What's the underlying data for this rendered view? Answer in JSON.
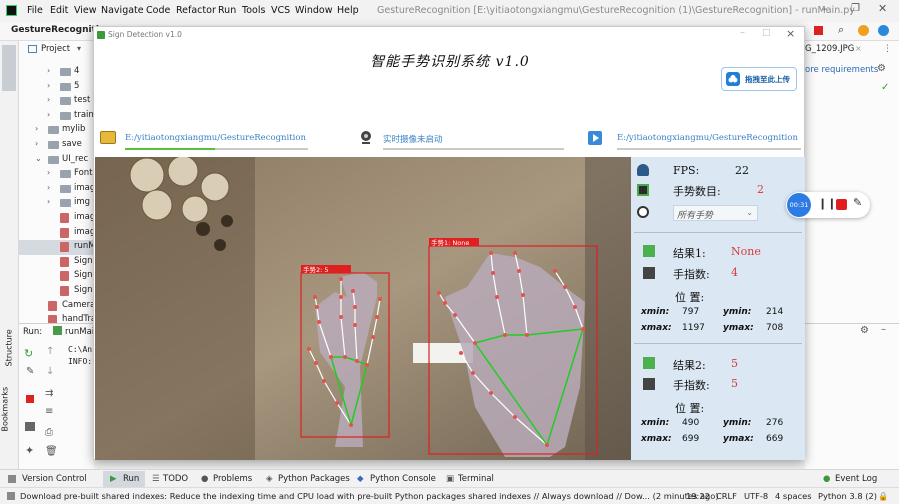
{
  "ide": {
    "menu": [
      "File",
      "Edit",
      "View",
      "Navigate",
      "Code",
      "Refactor",
      "Run",
      "Tools",
      "VCS",
      "Window",
      "Help"
    ],
    "title": "GestureRecognition [E:\\yitiaotongxiangmu\\GestureRecognition (1)\\GestureRecognition] - runMain.py",
    "project_name": "GestureRecognition",
    "project_label": "Project",
    "tree": [
      {
        "label": "4",
        "kind": "folder",
        "indent": 2
      },
      {
        "label": "5",
        "kind": "folder",
        "indent": 2
      },
      {
        "label": "test",
        "kind": "folder",
        "indent": 2
      },
      {
        "label": "train",
        "kind": "folder",
        "indent": 2
      },
      {
        "label": "mylib",
        "kind": "folder",
        "indent": 1
      },
      {
        "label": "save",
        "kind": "folder",
        "indent": 1
      },
      {
        "label": "UI_rec",
        "kind": "folder-open",
        "indent": 1
      },
      {
        "label": "Font",
        "kind": "folder",
        "indent": 2
      },
      {
        "label": "imag",
        "kind": "folder",
        "indent": 2
      },
      {
        "label": "img",
        "kind": "folder",
        "indent": 2
      },
      {
        "label": "imag",
        "kind": "file",
        "indent": 2
      },
      {
        "label": "imag",
        "kind": "file",
        "indent": 2
      },
      {
        "label": "runM",
        "kind": "file",
        "indent": 2
      },
      {
        "label": "Sign",
        "kind": "file",
        "indent": 2
      },
      {
        "label": "Sign",
        "kind": "file",
        "indent": 2
      },
      {
        "label": "Sign",
        "kind": "file",
        "indent": 2
      },
      {
        "label": "Camera",
        "kind": "file",
        "indent": 1
      },
      {
        "label": "handTra",
        "kind": "file",
        "indent": 1
      }
    ],
    "run_label": "Run:",
    "run_tab": "runMai",
    "console_lines": [
      "C:\\An",
      "INFO:"
    ],
    "editor_tab": "G_1209.JPG",
    "requirements_hint": "ore requirements",
    "side_labels": [
      "Structure",
      "Bookmarks"
    ],
    "bottom_tabs": [
      "Version Control",
      "Run",
      "TODO",
      "Problems",
      "Python Packages",
      "Python Console",
      "Terminal"
    ],
    "event_log": "Event Log",
    "status_msg": "Download pre-built shared indexes: Reduce the indexing time and CPU load with pre-built Python packages shared indexes // Always download // Dow... (2 minutes ago)",
    "status_right": [
      "19:22",
      "CRLF",
      "UTF-8",
      "4 spaces",
      "Python 3.8 (2)"
    ],
    "recording_time": "00:31"
  },
  "app": {
    "window_title": "Sign Detection v1.0",
    "heading": "智能手势识别系统 v1.0",
    "upload_label": "拖拽至此上传",
    "left_path": "E:/yitiaotongxiangmu/GestureRecognition",
    "camera_status": "实时摄像未启动",
    "right_path": "E:/yitiaotongxiangmu/GestureRecognition",
    "fps_label": "FPS:",
    "fps_value": "22",
    "gesture_count_label": "手势数目:",
    "gesture_count_value": "2",
    "filter_value": "所有手势",
    "results": [
      {
        "label": "结果1:",
        "value": "None",
        "fingers_label": "手指数:",
        "fingers": "4",
        "pos_label": "位 置:",
        "xmin": "797",
        "ymin": "214",
        "xmax": "1197",
        "ymax": "708"
      },
      {
        "label": "结果2:",
        "value": "5",
        "fingers_label": "手指数:",
        "fingers": "5",
        "pos_label": "位 置:",
        "xmin": "490",
        "ymin": "276",
        "xmax": "699",
        "ymax": "669"
      }
    ],
    "coord_labels": {
      "xmin": "xmin:",
      "ymin": "ymin:",
      "xmax": "xmax:",
      "ymax": "ymax:"
    },
    "boxes": [
      {
        "label": "手势2: 5"
      },
      {
        "label": "手势1: None"
      }
    ]
  },
  "colors": {
    "accent": "#3a82c4",
    "result": "#d83a3a",
    "panel": "#dbe8f4",
    "box": "#e02020",
    "skeleton": "#ffffff",
    "palm": "#22cc22"
  }
}
